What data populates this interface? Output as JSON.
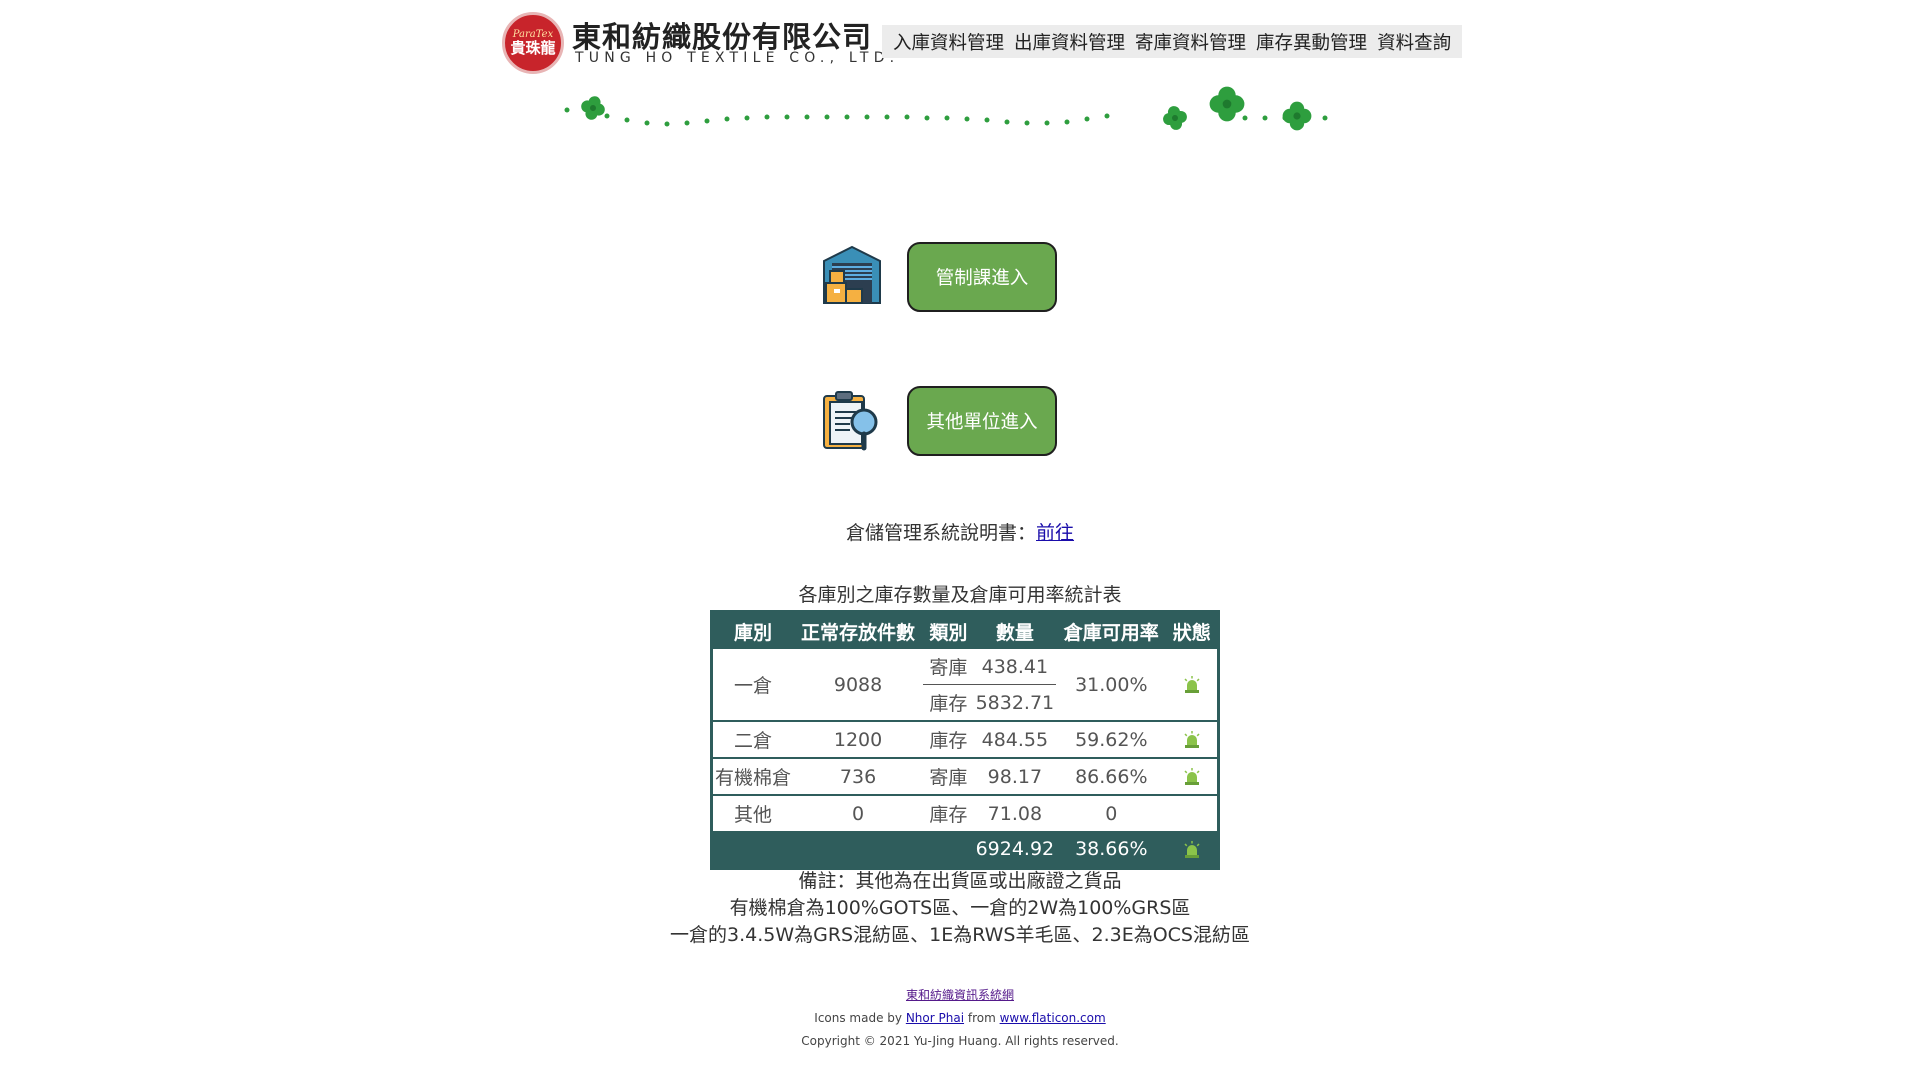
{
  "header": {
    "logo_sub": "ParaTex",
    "logo_main": "貴珠龍",
    "company_cn": "東和紡織股份有限公司",
    "company_en": "TUNG HO TEXTILE CO., LTD."
  },
  "nav": {
    "items": [
      "入庫資料管理",
      "出庫資料管理",
      "寄庫資料管理",
      "庫存異動管理",
      "資料查詢"
    ]
  },
  "entries": {
    "control_label": "管制課進入",
    "other_label": "其他單位進入"
  },
  "manual": {
    "label": "倉儲管理系統說明書：",
    "link": "前往"
  },
  "table": {
    "title": "各庫別之庫存數量及倉庫可用率統計表",
    "headers": [
      "庫別",
      "正常存放件數",
      "類別",
      "數量",
      "倉庫可用率",
      "狀態"
    ],
    "rows": {
      "w1": {
        "name": "一倉",
        "count": "9088",
        "type1": "寄庫",
        "qty1": "438.41",
        "type2": "庫存",
        "qty2": "5832.71",
        "rate": "31.00%",
        "status": "alarm-icon"
      },
      "w2": {
        "name": "二倉",
        "count": "1200",
        "type": "庫存",
        "qty": "484.55",
        "rate": "59.62%",
        "status": "alarm-icon"
      },
      "organic": {
        "name": "有機棉倉",
        "count": "736",
        "type": "寄庫",
        "qty": "98.17",
        "rate": "86.66%",
        "status": "alarm-icon"
      },
      "other": {
        "name": "其他",
        "count": "0",
        "type": "庫存",
        "qty": "71.08",
        "rate": "0"
      }
    },
    "total": {
      "qty": "6924.92",
      "rate": "38.66%",
      "status": "alarm-icon"
    }
  },
  "notes": [
    "備註：其他為在出貨區或出廠證之貨品",
    "有機棉倉為100%GOTS區、一倉的2W為100%GRS區",
    "一倉的3.4.5W為GRS混紡區、1E為RWS羊毛區、2.3E為OCS混紡區"
  ],
  "footer": {
    "system_link": "東和紡織資訊系統網",
    "icons_prefix": "Icons made by ",
    "author_link": "Nhor Phai",
    "from_text": " from ",
    "site_link": "www.flaticon.com",
    "copyright": "Copyright © 2021  Yu-Jing Huang. All rights reserved."
  },
  "colors": {
    "button_green": "#6aa84f",
    "table_header": "#2f5d5c",
    "alarm_green": "#8bc34a",
    "clover": "#2e9e3e"
  }
}
